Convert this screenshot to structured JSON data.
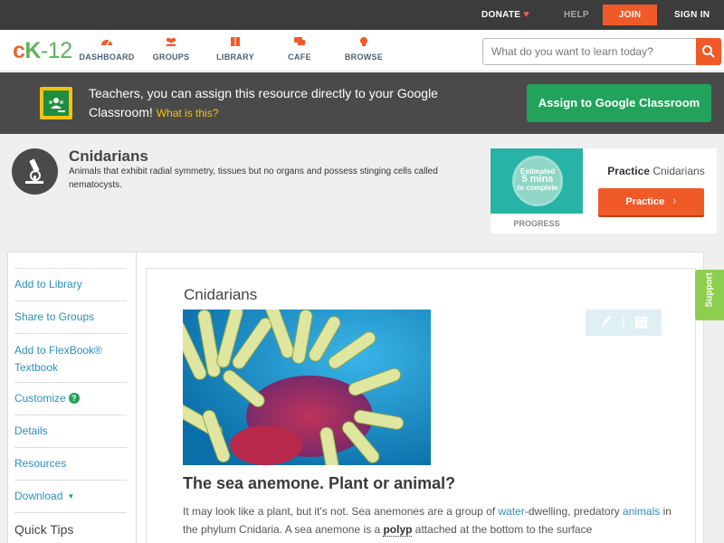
{
  "topbar": {
    "donate": "DONATE",
    "help": "HELP",
    "join": "JOIN",
    "signin": "SIGN IN"
  },
  "logo": {
    "c": "c",
    "k": "K",
    "n": "-12"
  },
  "nav": {
    "items": [
      {
        "label": "DASHBOARD",
        "icon": "gauge-icon"
      },
      {
        "label": "GROUPS",
        "icon": "people-icon"
      },
      {
        "label": "LIBRARY",
        "icon": "book-icon"
      },
      {
        "label": "CAFE",
        "icon": "chat-icon"
      },
      {
        "label": "BROWSE",
        "icon": "lightbulb-icon"
      }
    ],
    "search_placeholder": "What do you want to learn today?"
  },
  "classroom_banner": {
    "text": "Teachers, you can assign this resource directly to your Google Classroom!",
    "what_link": "What is this?",
    "button": "Assign to Google Classroom"
  },
  "concept": {
    "title": "Cnidarians",
    "description": "Animals that exhibit radial symmetry, tissues but no organs and possess stinging cells called nematocysts."
  },
  "practice": {
    "estimated": "Estimated",
    "mins": "5 mins",
    "to_complete": "to complete",
    "progress_label": "PROGRESS",
    "title_bold": "Practice",
    "title_rest": "Cnidarians",
    "button": "Practice"
  },
  "sidebar": {
    "items": [
      {
        "label": "Add to Library"
      },
      {
        "label": "Share to Groups"
      },
      {
        "label": "Add to FlexBook® Textbook"
      },
      {
        "label": "Customize"
      },
      {
        "label": "Details"
      },
      {
        "label": "Resources"
      },
      {
        "label": "Download"
      }
    ],
    "quick_tips": "Quick Tips"
  },
  "article": {
    "title": "Cnidarians",
    "heading": "The sea anemone. Plant or animal?",
    "p1": "It may look like a plant, but it's not. Sea anemones are a group of ",
    "link_water": "water",
    "p2": "-dwelling, predatory ",
    "link_animals": "animals",
    "p3": " in the phylum Cnidaria. A sea anemone is a ",
    "vocab_polyp": "polyp",
    "p4": " attached at the bottom to the surface"
  },
  "support_tab": "Support",
  "colors": {
    "accent_orange": "#f05a29",
    "google_green": "#21a35c",
    "link_blue": "#2a8fbd",
    "dark_bar": "#3c3c3c"
  }
}
